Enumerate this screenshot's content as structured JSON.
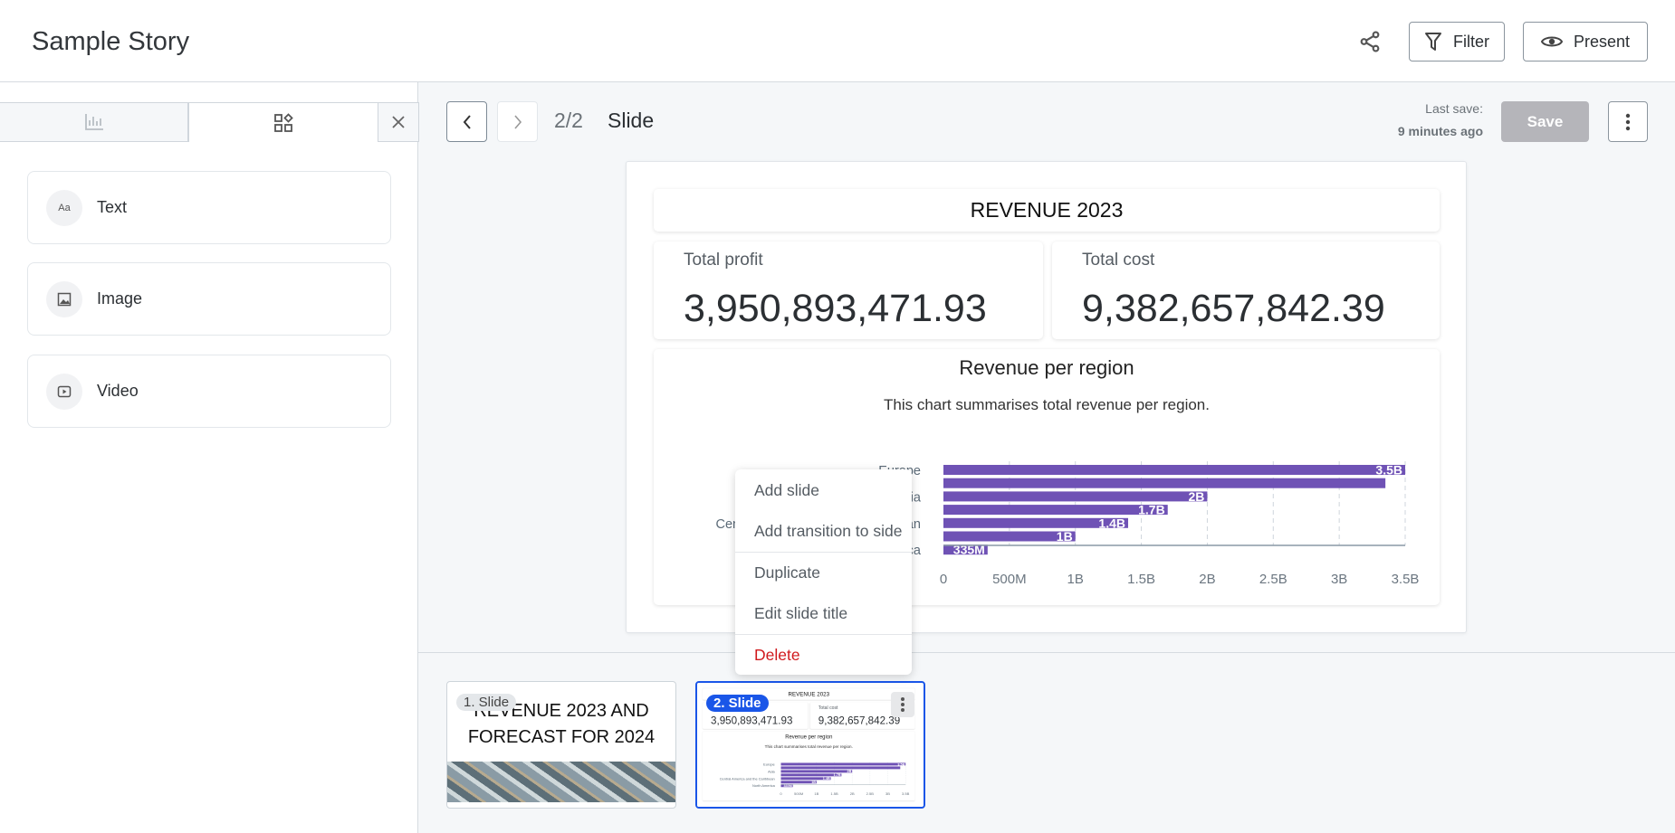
{
  "header": {
    "title": "Sample Story",
    "filter_label": "Filter",
    "present_label": "Present",
    "icons": [
      "share-icon",
      "filter-icon",
      "eye-icon"
    ]
  },
  "left_panel": {
    "tabs": [
      {
        "icon": "bar-chart-icon"
      },
      {
        "icon": "widgets-icon"
      }
    ],
    "close_icon": "close-icon",
    "items": [
      {
        "label": "Text",
        "icon": "Aa"
      },
      {
        "label": "Image",
        "icon": "image-icon"
      },
      {
        "label": "Video",
        "icon": "video-icon"
      }
    ]
  },
  "toolbar": {
    "page": "2/2",
    "slide_title": "Slide",
    "last_save_label": "Last save:",
    "last_save_time": "9 minutes ago",
    "save_label": "Save"
  },
  "slide": {
    "title": "REVENUE 2023",
    "kpis": [
      {
        "label": "Total profit",
        "value": "3,950,893,471.93"
      },
      {
        "label": "Total cost",
        "value": "9,382,657,842.39"
      }
    ],
    "chart_title": "Revenue per region",
    "chart_subtitle": "This chart summarises total revenue per region."
  },
  "chart_data": {
    "type": "bar",
    "orientation": "horizontal",
    "bar_color": "#6f52b5",
    "categories": [
      "Europe",
      "",
      "Asia",
      "",
      "Central America and the Caribbean",
      "",
      "North America"
    ],
    "values": [
      3500000000,
      3350000000,
      2000000000,
      1700000000,
      1400000000,
      1000000000,
      335000000
    ],
    "data_labels": [
      "3.5B",
      "",
      "2B",
      "1.7B",
      "1.4B",
      "1B",
      "335M"
    ],
    "xlim": [
      0,
      3500000000
    ],
    "x_ticks": [
      "0",
      "500M",
      "1B",
      "1.5B",
      "2B",
      "2.5B",
      "3B",
      "3.5B"
    ],
    "grid": "vertical dashed"
  },
  "context_menu": {
    "items": [
      "Add slide",
      "Add transition to side",
      "Duplicate",
      "Edit slide title"
    ],
    "delete_label": "Delete",
    "delete_color": "#d0191d"
  },
  "thumbnails": [
    {
      "badge": "1. Slide",
      "title": "REVENUE 2023 AND FORECAST FOR 2024"
    },
    {
      "badge": "2. Slide",
      "selected": true
    }
  ],
  "accent": "#1a56e8"
}
